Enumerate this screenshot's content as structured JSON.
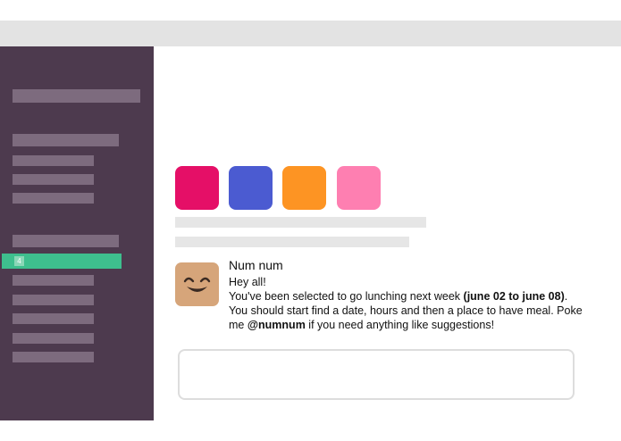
{
  "sidebar": {
    "active_item_badge": "4"
  },
  "swatches": [
    {
      "name": "swatch-pink-red",
      "color": "#e50f67"
    },
    {
      "name": "swatch-blue",
      "color": "#4b5bd1"
    },
    {
      "name": "swatch-orange",
      "color": "#fd9423"
    },
    {
      "name": "swatch-pink",
      "color": "#fe7fb1"
    }
  ],
  "message": {
    "author": "Num num",
    "greeting": "Hey all!",
    "line_before_dates": "You've been selected to go lunching next week ",
    "dates": "(june 02 to june 08)",
    "line_after_dates": ". You should start find a date, hours and then a place to have meal. Poke me ",
    "mention": "@numnum",
    "line_end": " if you need anything like suggestions!"
  },
  "colors": {
    "topbar": "#e3e3e3",
    "sidebar": "#4d3a4e",
    "sidebar_placeholder": "#7d6b7e",
    "active_item": "#3ebf8e",
    "avatar": "#d6a57a"
  }
}
